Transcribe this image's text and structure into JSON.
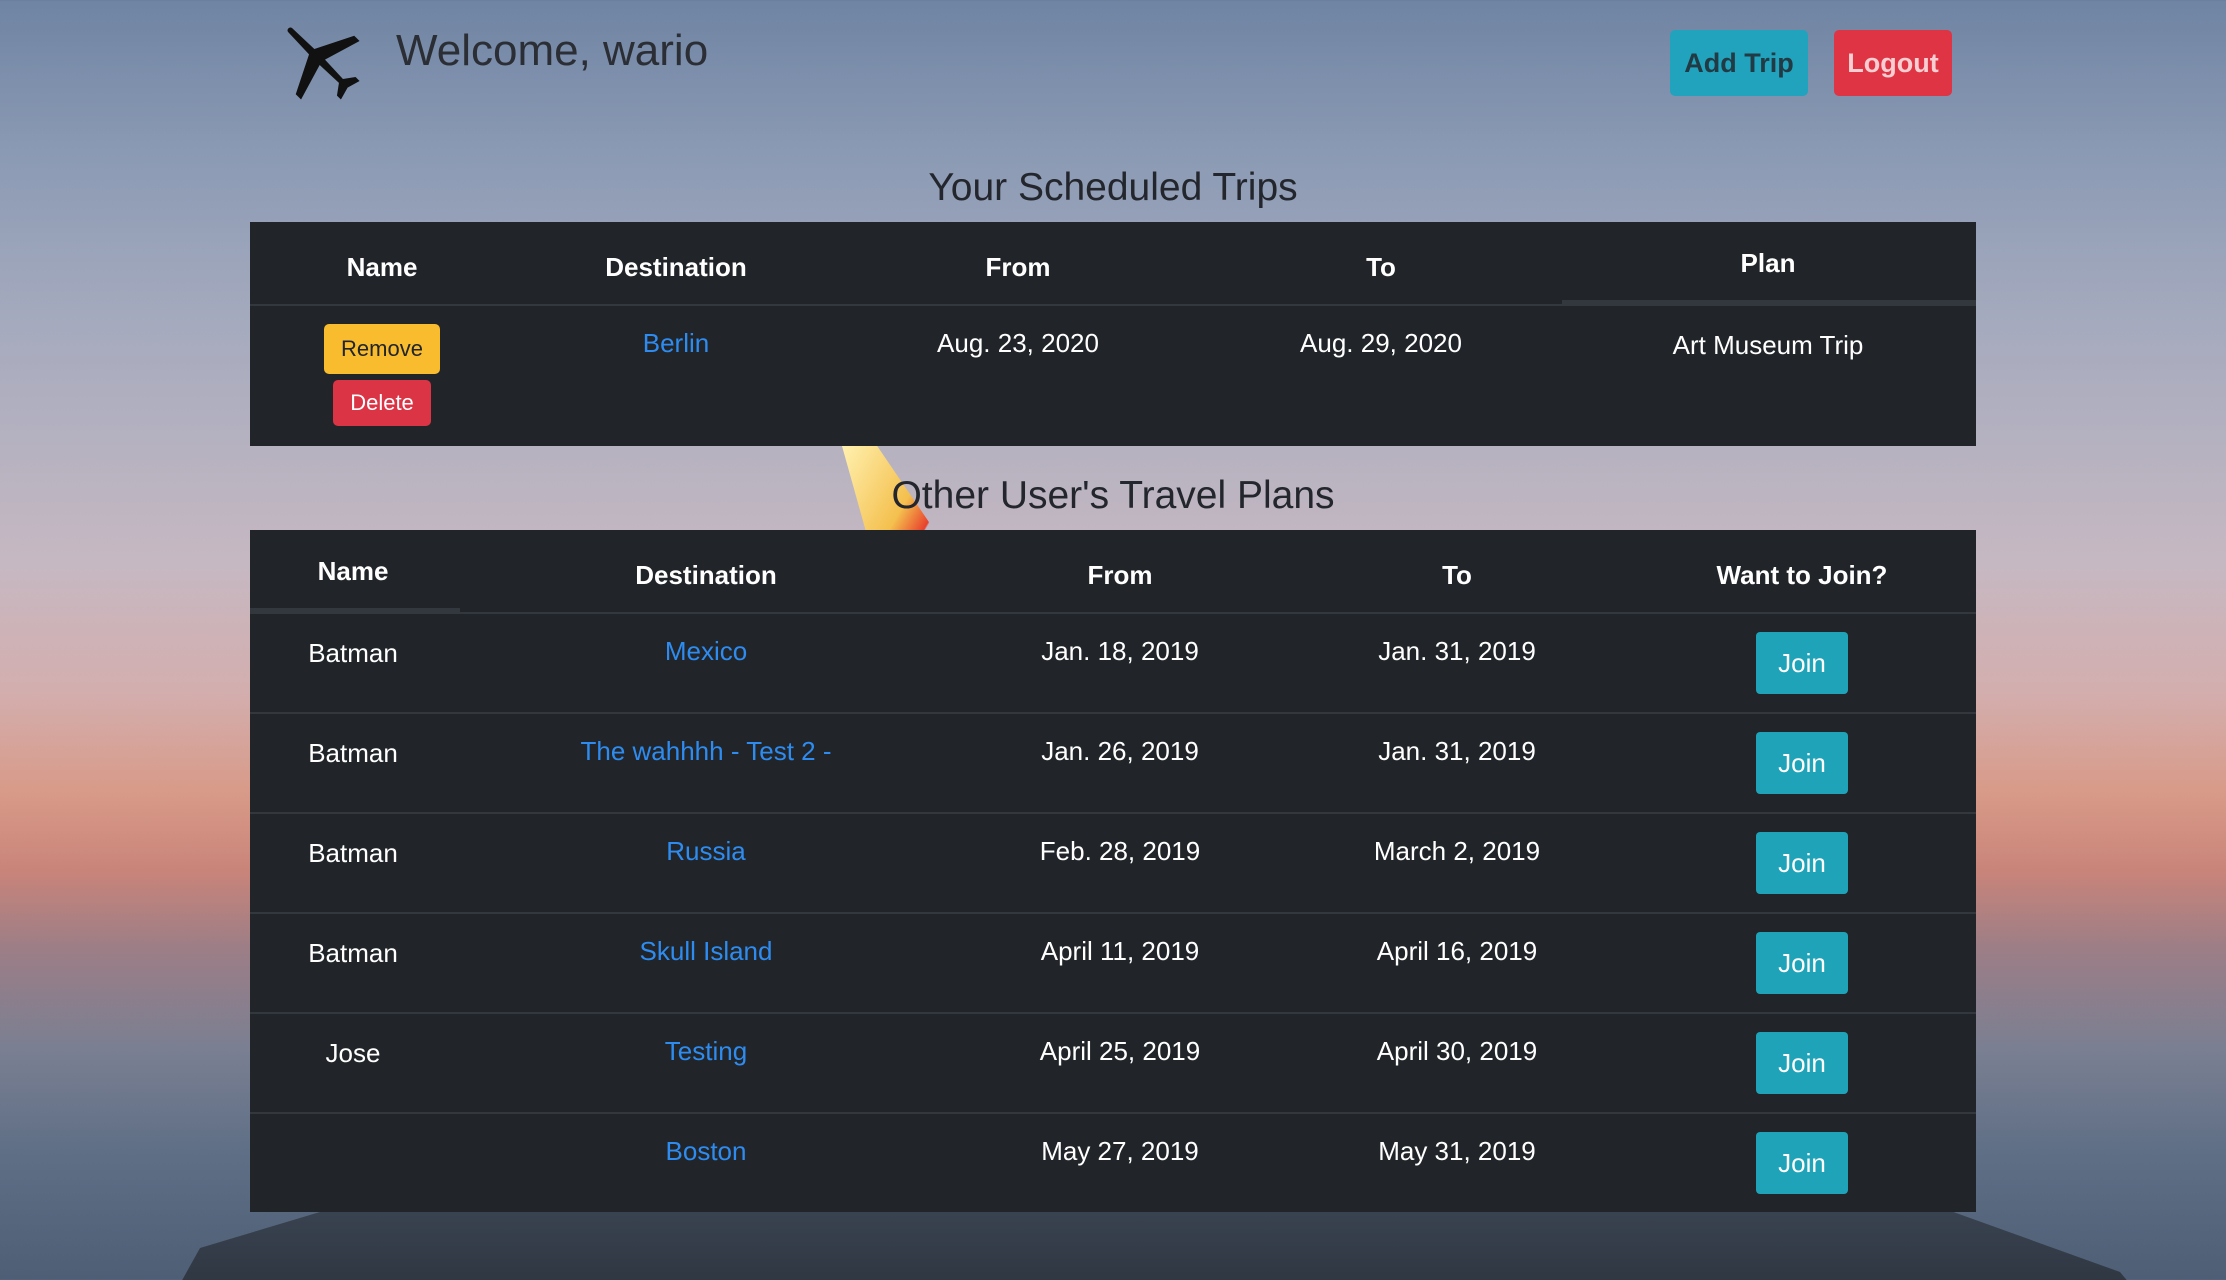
{
  "header": {
    "welcome": "Welcome, wario",
    "add_trip_label": "Add Trip",
    "logout_label": "Logout"
  },
  "scheduled": {
    "title": "Your Scheduled Trips",
    "columns": [
      "Name",
      "Destination",
      "From",
      "To",
      "Plan"
    ],
    "rows": [
      {
        "remove_label": "Remove",
        "delete_label": "Delete",
        "destination": "Berlin",
        "from": "Aug. 23, 2020",
        "to": "Aug. 29, 2020",
        "plan": "Art Museum Trip"
      }
    ]
  },
  "others": {
    "title": "Other User's Travel Plans",
    "columns": [
      "Name",
      "Destination",
      "From",
      "To",
      "Want to Join?"
    ],
    "rows": [
      {
        "name": "Batman",
        "destination": "Mexico",
        "from": "Jan. 18, 2019",
        "to": "Jan. 31, 2019",
        "join_label": "Join"
      },
      {
        "name": "Batman",
        "destination": "The wahhhh - Test 2 -",
        "from": "Jan. 26, 2019",
        "to": "Jan. 31, 2019",
        "join_label": "Join"
      },
      {
        "name": "Batman",
        "destination": "Russia",
        "from": "Feb. 28, 2019",
        "to": "March 2, 2019",
        "join_label": "Join"
      },
      {
        "name": "Batman",
        "destination": "Skull Island",
        "from": "April 11, 2019",
        "to": "April 16, 2019",
        "join_label": "Join"
      },
      {
        "name": "Jose",
        "destination": "Testing",
        "from": "April 25, 2019",
        "to": "April 30, 2019",
        "join_label": "Join"
      },
      {
        "name": "",
        "destination": "Boston",
        "from": "May 27, 2019",
        "to": "May 31, 2019",
        "join_label": "Join"
      }
    ]
  },
  "colors": {
    "table_bg": "#212529",
    "link": "#2e8cf0",
    "info": "#21a3bd",
    "danger": "#df3443",
    "warning": "#f9bc2e"
  },
  "icons": {
    "logo": "airplane-icon"
  }
}
